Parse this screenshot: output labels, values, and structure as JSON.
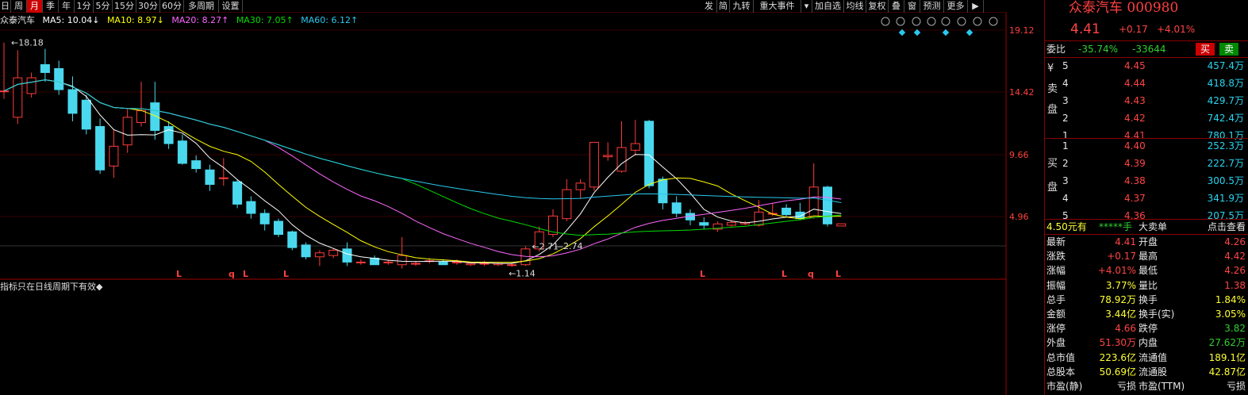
{
  "toolbar": {
    "left_items": [
      "日",
      "周",
      "月",
      "季",
      "年",
      "1分",
      "5分",
      "15分",
      "30分",
      "60分",
      "多周期",
      "设置"
    ],
    "active": "月",
    "right_items": [
      "发",
      "简",
      "九转",
      "重大事件",
      "▾",
      "加自选",
      "均线",
      "复权",
      "叠",
      "窗",
      "预测",
      "更多",
      "▶"
    ]
  },
  "indicators": {
    "stock": "众泰汽车",
    "ma5": "MA5: 10.04↓",
    "ma10": "MA10: 8.97↓",
    "ma20": "MA20: 8.27↑",
    "ma30": "MA30: 7.05↑",
    "ma60": "MA60: 6.12↑",
    "colors": {
      "ma5": "#ffffff",
      "ma10": "#ffff00",
      "ma20": "#ff66ff",
      "ma30": "#00dd00",
      "ma60": "#29c8ee"
    }
  },
  "chart_data": {
    "type": "candlestick",
    "y_ticks": [
      "19.12",
      "14.42",
      "9.66",
      "4.96"
    ],
    "annotations": {
      "high": "18.18",
      "low": "1.14",
      "mid1": "2.71",
      "mid2": "2.74"
    },
    "markers": [
      "L",
      "q",
      "L",
      "L",
      "L",
      "L",
      "q",
      "L"
    ],
    "candles": [
      {
        "o": 14.5,
        "c": 14.5,
        "h": 18.18,
        "l": 13.9
      },
      {
        "o": 12.5,
        "c": 15.5,
        "h": 17.6,
        "l": 12.0
      },
      {
        "o": 14.3,
        "c": 15.5,
        "h": 15.9,
        "l": 14.0
      },
      {
        "o": 16.5,
        "c": 15.9,
        "h": 17.7,
        "l": 15.2
      },
      {
        "o": 16.2,
        "c": 14.6,
        "h": 16.8,
        "l": 14.2
      },
      {
        "o": 14.6,
        "c": 12.8,
        "h": 15.6,
        "l": 12.2
      },
      {
        "o": 13.8,
        "c": 11.6,
        "h": 14.2,
        "l": 11.2
      },
      {
        "o": 11.8,
        "c": 8.5,
        "h": 12.4,
        "l": 8.2
      },
      {
        "o": 8.8,
        "c": 10.3,
        "h": 11.6,
        "l": 7.9
      },
      {
        "o": 10.4,
        "c": 12.5,
        "h": 13.1,
        "l": 9.8
      },
      {
        "o": 12.1,
        "c": 13.0,
        "h": 15.2,
        "l": 11.8
      },
      {
        "o": 13.6,
        "c": 11.5,
        "h": 15.2,
        "l": 10.8
      },
      {
        "o": 11.8,
        "c": 10.5,
        "h": 12.2,
        "l": 10.1
      },
      {
        "o": 10.7,
        "c": 9.0,
        "h": 11.2,
        "l": 8.9
      },
      {
        "o": 9.2,
        "c": 8.6,
        "h": 9.6,
        "l": 8.3
      },
      {
        "o": 8.5,
        "c": 7.4,
        "h": 8.9,
        "l": 6.9
      },
      {
        "o": 7.9,
        "c": 7.9,
        "h": 9.4,
        "l": 7.3
      },
      {
        "o": 7.6,
        "c": 5.9,
        "h": 7.8,
        "l": 5.6
      },
      {
        "o": 6.1,
        "c": 5.2,
        "h": 6.5,
        "l": 4.8
      },
      {
        "o": 5.2,
        "c": 4.4,
        "h": 5.5,
        "l": 3.9
      },
      {
        "o": 4.6,
        "c": 3.6,
        "h": 4.8,
        "l": 3.4
      },
      {
        "o": 3.8,
        "c": 2.6,
        "h": 3.9,
        "l": 2.4
      },
      {
        "o": 2.8,
        "c": 1.9,
        "h": 3.0,
        "l": 1.7
      },
      {
        "o": 1.9,
        "c": 2.2,
        "h": 2.4,
        "l": 1.2
      },
      {
        "o": 2.0,
        "c": 2.4,
        "h": 2.5,
        "l": 1.8
      },
      {
        "o": 2.5,
        "c": 1.5,
        "h": 3.0,
        "l": 1.2
      },
      {
        "o": 1.5,
        "c": 1.5,
        "h": 1.7,
        "l": 1.3
      },
      {
        "o": 1.8,
        "c": 1.3,
        "h": 2.0,
        "l": 1.3
      },
      {
        "o": 1.5,
        "c": 1.5,
        "h": 1.7,
        "l": 1.3
      },
      {
        "o": 1.3,
        "c": 2.0,
        "h": 3.4,
        "l": 1.0
      },
      {
        "o": 1.4,
        "c": 1.4,
        "h": 1.6,
        "l": 1.2
      },
      {
        "o": 1.6,
        "c": 1.6,
        "h": 1.8,
        "l": 1.4
      },
      {
        "o": 1.5,
        "c": 1.3,
        "h": 1.7,
        "l": 1.3
      },
      {
        "o": 1.5,
        "c": 1.5,
        "h": 1.7,
        "l": 1.3
      },
      {
        "o": 1.3,
        "c": 1.4,
        "h": 1.5,
        "l": 1.2
      },
      {
        "o": 1.4,
        "c": 1.4,
        "h": 1.6,
        "l": 1.2
      },
      {
        "o": 1.3,
        "c": 1.4,
        "h": 1.5,
        "l": 1.2
      },
      {
        "o": 1.3,
        "c": 1.3,
        "h": 1.5,
        "l": 1.14
      },
      {
        "o": 1.3,
        "c": 2.5,
        "h": 2.7,
        "l": 1.2
      },
      {
        "o": 2.5,
        "c": 3.8,
        "h": 4.2,
        "l": 2.3
      },
      {
        "o": 3.6,
        "c": 5.0,
        "h": 5.5,
        "l": 3.4
      },
      {
        "o": 4.8,
        "c": 7.0,
        "h": 7.8,
        "l": 4.6
      },
      {
        "o": 7.0,
        "c": 7.5,
        "h": 7.8,
        "l": 6.3
      },
      {
        "o": 7.2,
        "c": 10.6,
        "h": 10.6,
        "l": 6.9
      },
      {
        "o": 9.5,
        "c": 9.6,
        "h": 10.6,
        "l": 9.2
      },
      {
        "o": 8.4,
        "c": 10.2,
        "h": 12.2,
        "l": 8.3
      },
      {
        "o": 10.0,
        "c": 10.5,
        "h": 12.3,
        "l": 9.6
      },
      {
        "o": 12.2,
        "c": 7.3,
        "h": 12.3,
        "l": 7.1
      },
      {
        "o": 7.8,
        "c": 6.0,
        "h": 8.0,
        "l": 5.5
      },
      {
        "o": 6.0,
        "c": 5.2,
        "h": 6.5,
        "l": 4.9
      },
      {
        "o": 5.2,
        "c": 4.7,
        "h": 5.5,
        "l": 4.3
      },
      {
        "o": 4.5,
        "c": 4.3,
        "h": 4.9,
        "l": 4.0
      },
      {
        "o": 4.0,
        "c": 4.4,
        "h": 4.6,
        "l": 3.8
      },
      {
        "o": 4.3,
        "c": 4.5,
        "h": 4.6,
        "l": 4.2
      },
      {
        "o": 4.4,
        "c": 4.5,
        "h": 4.6,
        "l": 4.3
      },
      {
        "o": 4.3,
        "c": 5.3,
        "h": 6.2,
        "l": 4.2
      },
      {
        "o": 5.2,
        "c": 5.2,
        "h": 6.0,
        "l": 5.0
      },
      {
        "o": 5.6,
        "c": 5.1,
        "h": 5.9,
        "l": 4.9
      },
      {
        "o": 5.3,
        "c": 4.8,
        "h": 6.0,
        "l": 4.7
      },
      {
        "o": 4.9,
        "c": 7.2,
        "h": 9.0,
        "l": 4.8
      },
      {
        "o": 7.2,
        "c": 4.4,
        "h": 7.3,
        "l": 4.2
      },
      {
        "o": 4.24,
        "c": 4.41,
        "h": 4.42,
        "l": 4.26
      }
    ]
  },
  "note": "指标只在日线周期下有效◆",
  "quote": {
    "name": "众泰汽车 000980",
    "price": "4.41",
    "change": "+0.17",
    "change_pct": "+4.01%",
    "weibi_label": "委比",
    "weibi": "-35.74%",
    "weicha": "-33644",
    "buy_btn": "买",
    "sell_btn": "卖",
    "sell_side_label": "¥ 卖 盘",
    "buy_side_label": "买 盘",
    "asks": [
      {
        "lvl": "5",
        "price": "4.45",
        "vol": "457.4万"
      },
      {
        "lvl": "4",
        "price": "4.44",
        "vol": "418.8万"
      },
      {
        "lvl": "3",
        "price": "4.43",
        "vol": "429.7万"
      },
      {
        "lvl": "2",
        "price": "4.42",
        "vol": "742.4万"
      },
      {
        "lvl": "1",
        "price": "4.41",
        "vol": "780.1万"
      }
    ],
    "bids": [
      {
        "lvl": "1",
        "price": "4.40",
        "vol": "252.3万"
      },
      {
        "lvl": "2",
        "price": "4.39",
        "vol": "222.7万"
      },
      {
        "lvl": "3",
        "price": "4.38",
        "vol": "300.5万"
      },
      {
        "lvl": "4",
        "price": "4.37",
        "vol": "341.9万"
      },
      {
        "lvl": "5",
        "price": "4.36",
        "vol": "207.5万"
      }
    ],
    "bigorder": {
      "left": "4.50元有",
      "mid": "*****手",
      "big": "大卖单",
      "link": "点击查看"
    },
    "stats": [
      {
        "k1": "最新",
        "v1": "4.41",
        "c1": "red",
        "k2": "开盘",
        "v2": "4.26",
        "c2": "red"
      },
      {
        "k1": "涨跌",
        "v1": "+0.17",
        "c1": "red",
        "k2": "最高",
        "v2": "4.42",
        "c2": "red"
      },
      {
        "k1": "涨幅",
        "v1": "+4.01%",
        "c1": "red",
        "k2": "最低",
        "v2": "4.26",
        "c2": "red"
      },
      {
        "k1": "振幅",
        "v1": "3.77%",
        "c1": "yellow",
        "k2": "量比",
        "v2": "1.38",
        "c2": "red"
      },
      {
        "k1": "总手",
        "v1": "78.92万",
        "c1": "yellow",
        "k2": "换手",
        "v2": "1.84%",
        "c2": "yellow"
      },
      {
        "k1": "金额",
        "v1": "3.44亿",
        "c1": "yellow",
        "k2": "换手(实)",
        "v2": "3.05%",
        "c2": "yellow"
      },
      {
        "k1": "涨停",
        "v1": "4.66",
        "c1": "red",
        "k2": "跌停",
        "v2": "3.82",
        "c2": "green"
      },
      {
        "k1": "外盘",
        "v1": "51.30万",
        "c1": "red",
        "k2": "内盘",
        "v2": "27.62万",
        "c2": "green"
      },
      {
        "k1": "总市值",
        "v1": "223.6亿",
        "c1": "yellow",
        "k2": "流通值",
        "v2": "189.1亿",
        "c2": "yellow"
      },
      {
        "k1": "总股本",
        "v1": "50.69亿",
        "c1": "yellow",
        "k2": "流通股",
        "v2": "42.87亿",
        "c2": "yellow"
      },
      {
        "k1": "市盈(静)",
        "v1": "亏损",
        "c1": "white",
        "k2": "市盈(TTM)",
        "v2": "亏损",
        "c2": "white"
      }
    ]
  }
}
